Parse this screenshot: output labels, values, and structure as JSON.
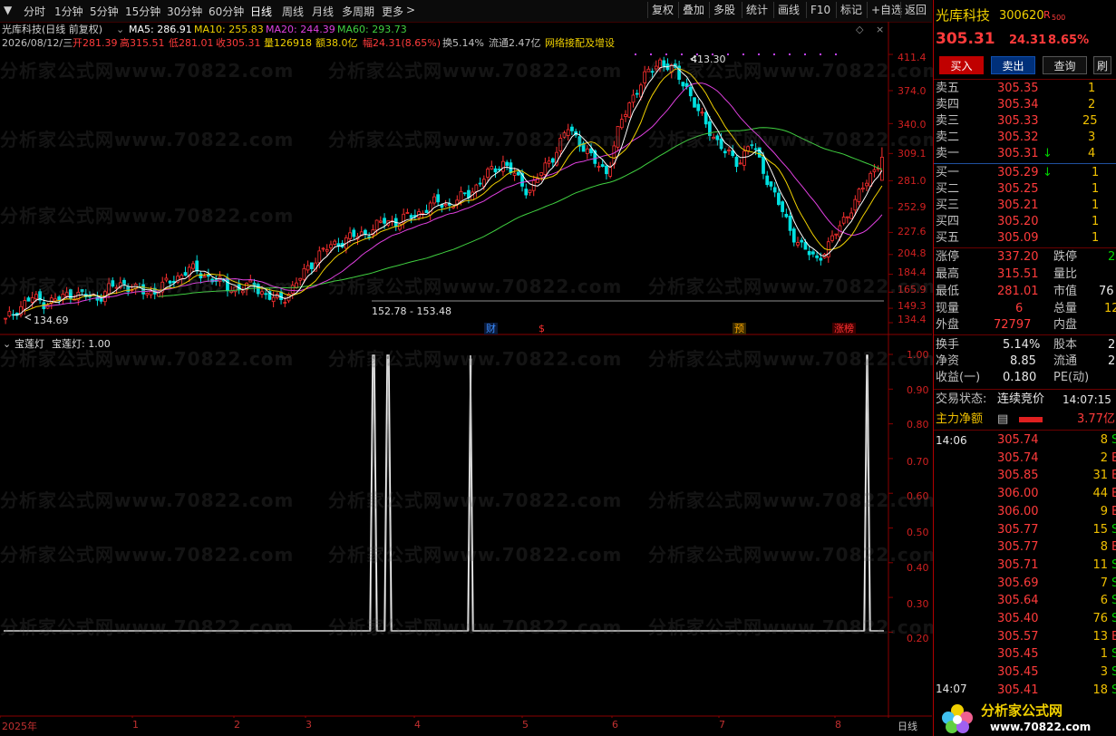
{
  "toolbar": {
    "periods": [
      "分时",
      "1分钟",
      "5分钟",
      "15分钟",
      "30分钟",
      "60分钟",
      "日线",
      "周线",
      "月线",
      "多周期",
      "更多"
    ],
    "active_period": "日线",
    "more_arrow": ">",
    "buttons": [
      "复权",
      "叠加",
      "多股",
      "统计",
      "画线",
      "F10",
      "标记",
      "+自选",
      "返回"
    ]
  },
  "chart_header": {
    "title": "光库科技(日线 前复权)",
    "ma": [
      {
        "label": "MA5: 286.91",
        "color": "#ffffff"
      },
      {
        "label": "MA10: 255.83",
        "color": "#f0d000"
      },
      {
        "label": "MA20: 244.39",
        "color": "#e040e0"
      },
      {
        "label": "MA60: 293.73",
        "color": "#40d040"
      }
    ],
    "info": {
      "date": "2026/08/12/三",
      "open": "开281.39",
      "high": "高315.51",
      "low": "低281.01",
      "close": "收305.31",
      "volume": "量126918",
      "amount": "额38.0亿",
      "change": "幅24.31(8.65%)",
      "turnover": "换5.14%",
      "float": "流通2.47亿",
      "concept": "网络接配及增设"
    }
  },
  "price_axis": [
    "411.4",
    "374.0",
    "340.0",
    "309.1",
    "281.0",
    "252.9",
    "227.6",
    "204.8",
    "184.4",
    "165.9",
    "149.3",
    "134.4"
  ],
  "annotations": {
    "peak": "413.30",
    "low_left": "134.69",
    "range": "152.78 - 153.48",
    "events": [
      {
        "text": "财",
        "color": "#3a8cff"
      },
      {
        "text": "$",
        "color": "#ff3030"
      },
      {
        "text": "预",
        "color": "#f0a000"
      },
      {
        "text": "涨榜",
        "color": "#ff3030"
      }
    ]
  },
  "indicator": {
    "title": "宝莲灯",
    "value": "宝莲灯: 1.00",
    "axis": [
      "1.00",
      "0.90",
      "0.80",
      "0.70",
      "0.60",
      "0.50",
      "0.40",
      "0.30",
      "0.20"
    ],
    "signal_values": [
      0,
      1,
      1,
      0,
      1,
      0,
      0,
      1
    ]
  },
  "x_axis": [
    "2025年",
    "1",
    "2",
    "3",
    "4",
    "5",
    "6",
    "7",
    "8"
  ],
  "x_axis_right": "日线",
  "watermark": "分析家公式网www.70822.com",
  "logo": {
    "text": "分析家公式网",
    "url": "www.70822.com"
  },
  "chart_data": {
    "type": "candlestick",
    "title": "光库科技(日线 前复权)",
    "ylim": [
      134.4,
      413.3
    ],
    "price_ticks": [
      411.4,
      374.0,
      340.0,
      309.1,
      281.0,
      252.9,
      227.6,
      204.8,
      184.4,
      165.9,
      149.3,
      134.4
    ],
    "x_tick_labels": [
      "2025年",
      "1",
      "2",
      "3",
      "4",
      "5",
      "6",
      "7",
      "8"
    ],
    "marked_high": 413.3,
    "marked_low": 134.69,
    "last": {
      "open": 281.39,
      "high": 315.51,
      "low": 281.01,
      "close": 305.31
    },
    "close_series_approx": [
      136,
      150,
      160,
      155,
      158,
      165,
      162,
      160,
      170,
      175,
      168,
      165,
      172,
      180,
      190,
      185,
      178,
      172,
      168,
      175,
      160,
      158,
      170,
      190,
      205,
      215,
      220,
      225,
      230,
      240,
      238,
      245,
      250,
      260,
      255,
      265,
      275,
      290,
      300,
      285,
      270,
      290,
      310,
      335,
      320,
      300,
      290,
      340,
      370,
      390,
      405,
      395,
      380,
      350,
      330,
      310,
      300,
      320,
      290,
      260,
      230,
      210,
      200,
      215,
      240,
      260,
      285,
      305
    ]
  },
  "stock": {
    "name": "光库科技",
    "code": "300620",
    "tag": "R",
    "tag_num": "500",
    "price": "305.31",
    "change": "24.31",
    "pct": "8.65%",
    "btn_buy": "买入",
    "btn_sell": "卖出",
    "btn_query": "查询",
    "asks": [
      {
        "label": "卖五",
        "price": "305.35",
        "vol": "1"
      },
      {
        "label": "卖四",
        "price": "305.34",
        "vol": "2"
      },
      {
        "label": "卖三",
        "price": "305.33",
        "vol": "25"
      },
      {
        "label": "卖二",
        "price": "305.32",
        "vol": "3"
      },
      {
        "label": "卖一",
        "price": "305.31",
        "vol": "4",
        "arrow": "↓"
      }
    ],
    "bids": [
      {
        "label": "买一",
        "price": "305.29",
        "vol": "1",
        "arrow": "↓"
      },
      {
        "label": "买二",
        "price": "305.25",
        "vol": "1"
      },
      {
        "label": "买三",
        "price": "305.21",
        "vol": "1"
      },
      {
        "label": "买四",
        "price": "305.20",
        "vol": "1"
      },
      {
        "label": "买五",
        "price": "305.09",
        "vol": "1"
      }
    ],
    "stats": [
      {
        "l1": "涨停",
        "v1": "337.20",
        "l2": "跌停",
        "v2": "2"
      },
      {
        "l1": "最高",
        "v1": "315.51",
        "l2": "量比",
        "v2": ""
      },
      {
        "l1": "最低",
        "v1": "281.01",
        "l2": "市值",
        "v2": "76"
      },
      {
        "l1": "现量",
        "v1": "6",
        "l2": "总量",
        "v2": "12"
      },
      {
        "l1": "外盘",
        "v1": "72797",
        "l2": "内盘",
        "v2": ""
      }
    ],
    "stats2": [
      {
        "l1": "换手",
        "v1": "5.14%",
        "l2": "股本",
        "v2": "2"
      },
      {
        "l1": "净资",
        "v1": "8.85",
        "l2": "流通",
        "v2": "2"
      },
      {
        "l1": "收益(一)",
        "v1": "0.180",
        "l2": "PE(动)",
        "v2": ""
      }
    ],
    "trade_state_label": "交易状态:",
    "trade_state": "连续竞价",
    "trade_time": "14:07:15",
    "main_flow_label": "主力净额",
    "main_flow": "3.77亿",
    "ticks_time1": "14:06",
    "ticks_time2": "14:07",
    "ticks": [
      {
        "price": "305.74",
        "vol": "8",
        "f": "S"
      },
      {
        "price": "305.74",
        "vol": "2",
        "f": "B"
      },
      {
        "price": "305.85",
        "vol": "31",
        "f": "B"
      },
      {
        "price": "306.00",
        "vol": "44",
        "f": "B"
      },
      {
        "price": "306.00",
        "vol": "9",
        "f": "B"
      },
      {
        "price": "305.77",
        "vol": "15",
        "f": "S"
      },
      {
        "price": "305.77",
        "vol": "8",
        "f": "B"
      },
      {
        "price": "305.71",
        "vol": "11",
        "f": "S"
      },
      {
        "price": "305.69",
        "vol": "7",
        "f": "S"
      },
      {
        "price": "305.64",
        "vol": "6",
        "f": "S"
      },
      {
        "price": "305.40",
        "vol": "76",
        "f": "S"
      },
      {
        "price": "305.57",
        "vol": "13",
        "f": "B"
      },
      {
        "price": "305.45",
        "vol": "1",
        "f": "S"
      },
      {
        "price": "305.45",
        "vol": "3",
        "f": "S"
      },
      {
        "price": "305.41",
        "vol": "18",
        "f": "S"
      },
      {
        "price": "305.41",
        "vol": "18",
        "f": "S"
      }
    ]
  }
}
